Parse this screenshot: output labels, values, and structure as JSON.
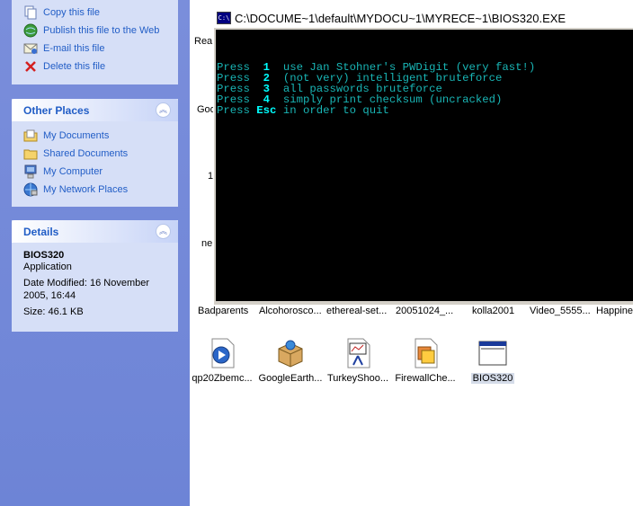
{
  "task_pane": {
    "file_tasks": [
      {
        "label": "Copy this file",
        "icon": "copy-icon"
      },
      {
        "label": "Publish this file to the Web",
        "icon": "publish-web-icon"
      },
      {
        "label": "E-mail this file",
        "icon": "email-icon"
      },
      {
        "label": "Delete this file",
        "icon": "delete-icon"
      }
    ],
    "other_places": {
      "title": "Other Places",
      "items": [
        {
          "label": "My Documents",
          "icon": "my-documents-icon"
        },
        {
          "label": "Shared Documents",
          "icon": "folder-icon"
        },
        {
          "label": "My Computer",
          "icon": "my-computer-icon"
        },
        {
          "label": "My Network Places",
          "icon": "network-places-icon"
        }
      ]
    },
    "details": {
      "title": "Details",
      "name": "BIOS320",
      "type": "Application",
      "modified_line1": "Date Modified: 16 November",
      "modified_line2": "2005, 16:44",
      "size": "Size: 46.1 KB"
    }
  },
  "content": {
    "partial_labels": [
      "Rea",
      "Goo",
      "1",
      "ne"
    ],
    "row_labels": [
      "Badparents",
      "Alcohorosco...",
      "ethereal-set...",
      "20051024_...",
      "kolla2001",
      "Video_5555...",
      "Happines"
    ],
    "files": [
      {
        "name": "qp20Zbemc...",
        "icon": "media-file-icon"
      },
      {
        "name": "GoogleEarth...",
        "icon": "installer-box-icon"
      },
      {
        "name": "TurkeyShoo...",
        "icon": "presentation-file-icon"
      },
      {
        "name": "FirewallChe...",
        "icon": "setup-file-icon"
      },
      {
        "name": "BIOS320",
        "icon": "application-window-icon",
        "selected": true
      }
    ]
  },
  "console": {
    "title": "C:\\DOCUME~1\\default\\MYDOCU~1\\MYRECE~1\\BIOS320.EXE",
    "icon_text": "C:\\",
    "lines": [
      {
        "press": "Press",
        "key": "1",
        "text": "use Jan Stohner's PWDigit (very fast!)"
      },
      {
        "press": "Press",
        "key": "2",
        "text": "(not very) intelligent bruteforce"
      },
      {
        "press": "Press",
        "key": "3",
        "text": "all passwords bruteforce"
      },
      {
        "press": "Press",
        "key": "4",
        "text": "simply print checksum (uncracked)"
      },
      {
        "press": "Press",
        "key": "Esc",
        "text": "in order to quit"
      }
    ]
  },
  "colors": {
    "taskpane_bg": "#7a8edb",
    "panel_body": "#d6dff7",
    "link_blue": "#215dc6",
    "console_text": "#19b5b5",
    "console_key": "#00ffff"
  }
}
